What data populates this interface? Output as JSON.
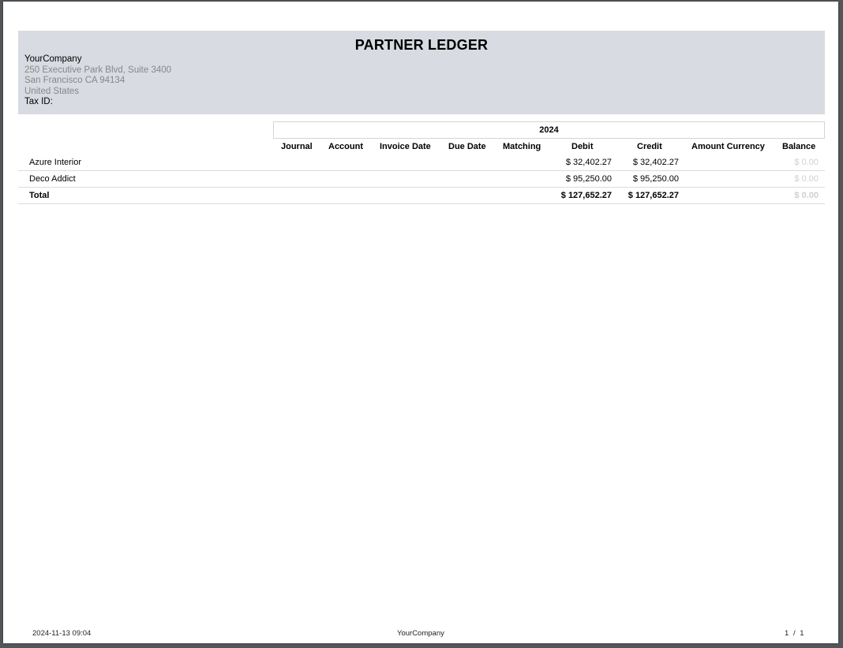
{
  "report": {
    "title": "PARTNER LEDGER"
  },
  "company": {
    "name": "YourCompany",
    "address_line1": "250 Executive Park Blvd, Suite 3400",
    "address_line2": "San Francisco CA 94134",
    "country": "United States",
    "tax_id_label": "Tax ID:"
  },
  "table": {
    "period": "2024",
    "columns": {
      "journal": "Journal",
      "account": "Account",
      "invoice_date": "Invoice Date",
      "due_date": "Due Date",
      "matching": "Matching",
      "debit": "Debit",
      "credit": "Credit",
      "amount_currency": "Amount Currency",
      "balance": "Balance"
    },
    "rows": [
      {
        "partner": "Azure Interior",
        "debit": "$ 32,402.27",
        "credit": "$ 32,402.27",
        "balance": "$ 0.00"
      },
      {
        "partner": "Deco Addict",
        "debit": "$ 95,250.00",
        "credit": "$ 95,250.00",
        "balance": "$ 0.00"
      }
    ],
    "total": {
      "label": "Total",
      "debit": "$ 127,652.27",
      "credit": "$ 127,652.27",
      "balance": "$ 0.00"
    }
  },
  "footer": {
    "timestamp": "2024-11-13 09:04",
    "company": "YourCompany",
    "page_current": "1",
    "page_separator": "/",
    "page_total": "1"
  },
  "colors": {
    "header_band": "#d8dbe1",
    "muted_text": "#878787",
    "zero_balance": "#d0d0d0"
  }
}
